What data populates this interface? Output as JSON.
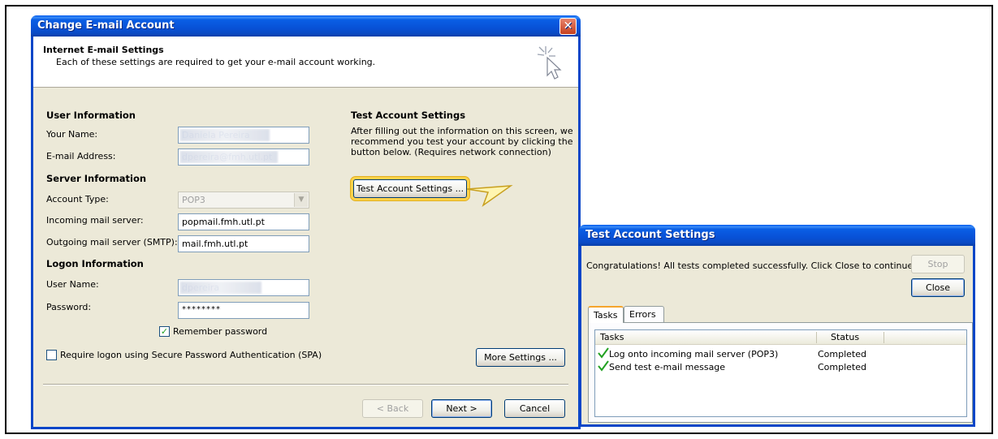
{
  "change_account": {
    "title": "Change E-mail Account",
    "header_title": "Internet E-mail Settings",
    "header_subtitle": "Each of these settings are required to get your e-mail account working.",
    "user_info": {
      "title": "User Information",
      "your_name_label": "Your Name:",
      "your_name_value": "Daniela Pereira",
      "email_label": "E-mail Address:",
      "email_value": "dpereira@fmh.utl.pt"
    },
    "server_info": {
      "title": "Server Information",
      "account_type_label": "Account Type:",
      "account_type_value": "POP3",
      "incoming_label": "Incoming mail server:",
      "incoming_value": "popmail.fmh.utl.pt",
      "outgoing_label": "Outgoing mail server (SMTP):",
      "outgoing_value": "mail.fmh.utl.pt"
    },
    "logon_info": {
      "title": "Logon Information",
      "user_name_label": "User Name:",
      "user_name_value": "dpereira",
      "password_label": "Password:",
      "password_value": "********",
      "remember_label": "Remember password",
      "remember_checked": true,
      "spa_label": "Require logon using Secure Password Authentication (SPA)",
      "spa_checked": false
    },
    "test_section": {
      "title": "Test Account Settings",
      "description_lines": [
        "After filling out the information on this screen, we",
        "recommend you test your account by clicking the",
        "button below. (Requires network connection)"
      ],
      "button_label": "Test Account Settings ..."
    },
    "more_settings_label": "More Settings ...",
    "back_label": "< Back",
    "next_label": "Next >",
    "cancel_label": "Cancel",
    "close_glyph": "✕"
  },
  "test_window": {
    "title": "Test Account Settings",
    "message": "Congratulations! All tests completed successfully. Click Close to continue.",
    "stop_label": "Stop",
    "close_label": "Close",
    "tabs": [
      "Tasks",
      "Errors"
    ],
    "columns": [
      "Tasks",
      "Status"
    ],
    "rows": [
      {
        "task": "Log onto incoming mail server (POP3)",
        "status": "Completed"
      },
      {
        "task": "Send test e-mail message",
        "status": "Completed"
      }
    ]
  },
  "colors": {
    "titlebar": "#0a5fe6",
    "dialog_bg": "#ece9d8",
    "highlight": "#ffd24a",
    "check_green": "#21a121"
  }
}
